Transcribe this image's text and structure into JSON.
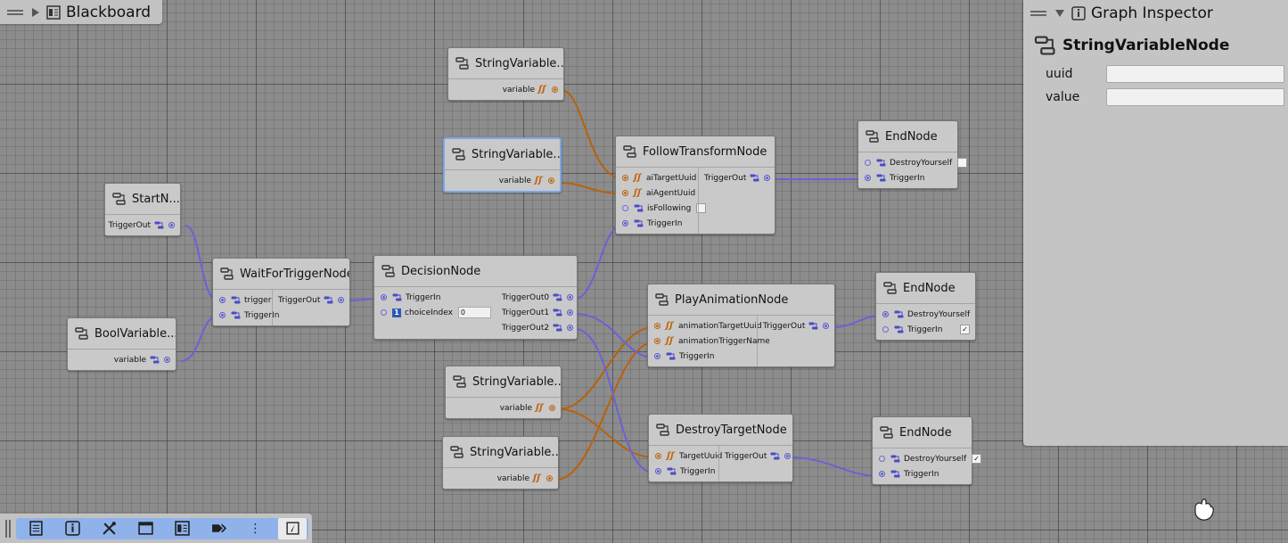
{
  "blackboard": {
    "title": "Blackboard"
  },
  "inspector": {
    "title": "Graph Inspector",
    "node_title": "StringVariableNode",
    "fields": [
      {
        "label": "uuid",
        "value": ""
      },
      {
        "label": "value",
        "value": ""
      }
    ]
  },
  "nodes": {
    "strvar1": {
      "title": "StringVariable...",
      "out": "variable"
    },
    "strvar2": {
      "title": "StringVariable...",
      "out": "variable"
    },
    "strvar3": {
      "title": "StringVariable...",
      "out": "variable"
    },
    "strvar4": {
      "title": "StringVariable...",
      "out": "variable"
    },
    "start": {
      "title": "StartN...",
      "out": "TriggerOut"
    },
    "boolvar": {
      "title": "BoolVariable...",
      "out": "variable"
    },
    "wait": {
      "title": "WaitForTriggerNode",
      "in": [
        "trigger",
        "TriggerIn"
      ],
      "out": "TriggerOut"
    },
    "decision": {
      "title": "DecisionNode",
      "in": [
        "TriggerIn",
        "choiceIndex"
      ],
      "choice_value": "0",
      "out": [
        "TriggerOut0",
        "TriggerOut1",
        "TriggerOut2"
      ]
    },
    "follow": {
      "title": "FollowTransformNode",
      "in": [
        "aiTargetUuid",
        "aiAgentUuid",
        "isFollowing",
        "TriggerIn"
      ],
      "out": "TriggerOut"
    },
    "play": {
      "title": "PlayAnimationNode",
      "in": [
        "animationTargetUuid",
        "animationTriggerName",
        "TriggerIn"
      ],
      "out": "TriggerOut"
    },
    "destroy": {
      "title": "DestroyTargetNode",
      "in": [
        "TargetUuid",
        "TriggerIn"
      ],
      "out": "TriggerOut"
    },
    "end1": {
      "title": "EndNode",
      "in": [
        "DestroyYourself",
        "TriggerIn"
      ],
      "destroy_checked": ""
    },
    "end2": {
      "title": "EndNode",
      "in": [
        "DestroyYourself",
        "TriggerIn"
      ],
      "triggerin_checked": "✓"
    },
    "end3": {
      "title": "EndNode",
      "in": [
        "DestroyYourself",
        "TriggerIn"
      ],
      "destroy_checked": "✓"
    }
  },
  "toolbar": {
    "buttons": [
      "list-icon",
      "info-icon",
      "tools-icon",
      "window-icon",
      "panel-icon",
      "flow-icon",
      "more-icon",
      "compass-icon"
    ],
    "more_label": "⋮"
  },
  "colors": {
    "trigger_wire": "#6b62d6",
    "string_wire": "#b8620c",
    "selected_outline": "#7aa6ea",
    "grid_bg": "#8c8c8c"
  }
}
